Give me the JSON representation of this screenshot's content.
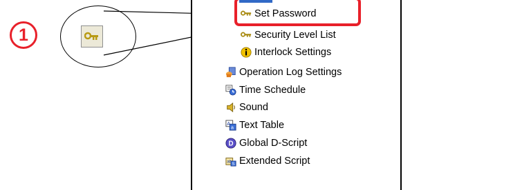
{
  "callout": {
    "number": "1",
    "color": "#e8202a"
  },
  "tree": {
    "items": [
      {
        "label": "Set Password",
        "icon": "key-icon"
      },
      {
        "label": "Security Level List",
        "icon": "key-icon"
      },
      {
        "label": "Interlock Settings",
        "icon": "info-icon"
      },
      {
        "label": "Operation Log Settings",
        "icon": "log-icon"
      },
      {
        "label": "Time Schedule",
        "icon": "schedule-icon"
      },
      {
        "label": "Sound",
        "icon": "speaker-icon"
      },
      {
        "label": "Text Table",
        "icon": "text-table-icon"
      },
      {
        "label": "Global D-Script",
        "icon": "d-script-icon"
      },
      {
        "label": "Extended Script",
        "icon": "extended-script-icon"
      }
    ]
  },
  "highlight": {
    "target": "Set Password"
  }
}
